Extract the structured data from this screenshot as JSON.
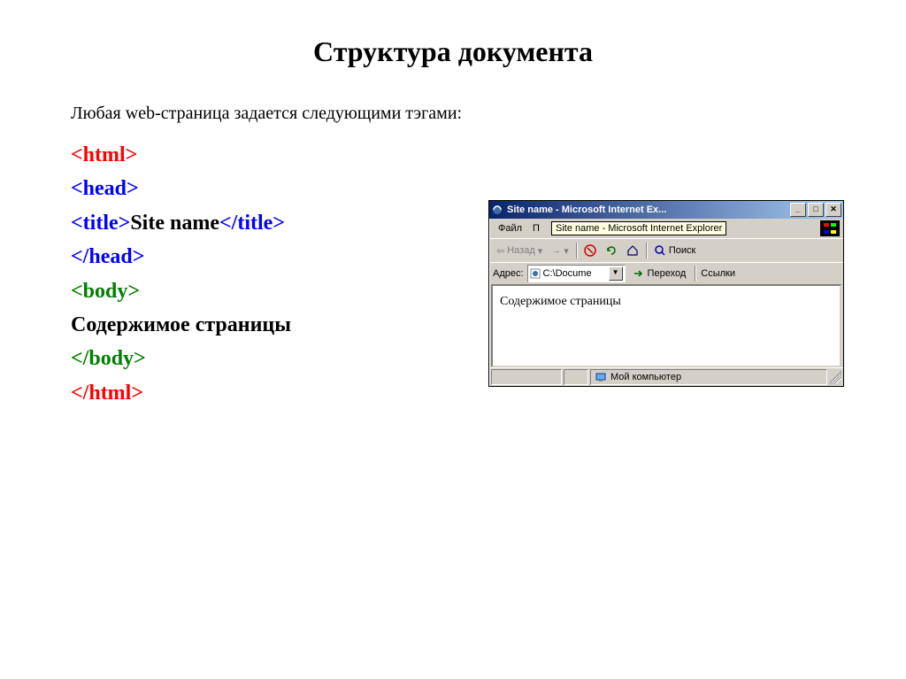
{
  "title": "Структура документа",
  "intro": "Любая web-страница задается следующими тэгами:",
  "code": {
    "html_open": "<html>",
    "head_open": "<head>",
    "title_open": "<title>",
    "title_text": "Site name",
    "title_close": "</title>",
    "head_close": "</head>",
    "body_open": "<body>",
    "body_content": "Содержимое страницы",
    "body_close": "</body>",
    "html_close": "</html>"
  },
  "ie": {
    "title": "Site name - Microsoft Internet Ex...",
    "tooltip": "Site name - Microsoft Internet Explorer",
    "menu_file": "Файл",
    "menu_edit": "П",
    "nav_back": "Назад",
    "nav_search": "Поиск",
    "addr_label": "Адрес:",
    "addr_value": "C:\\Docume",
    "go_label": "Переход",
    "links_label": "Ссылки",
    "page_body": "Содержимое страницы",
    "zone_label": "Мой компьютер",
    "btn_min": "_",
    "btn_max": "□",
    "btn_close": "✕",
    "drop_glyph": "▼",
    "back_arrow": "⇦",
    "fwd_arrow": "→",
    "chev": "▾"
  }
}
